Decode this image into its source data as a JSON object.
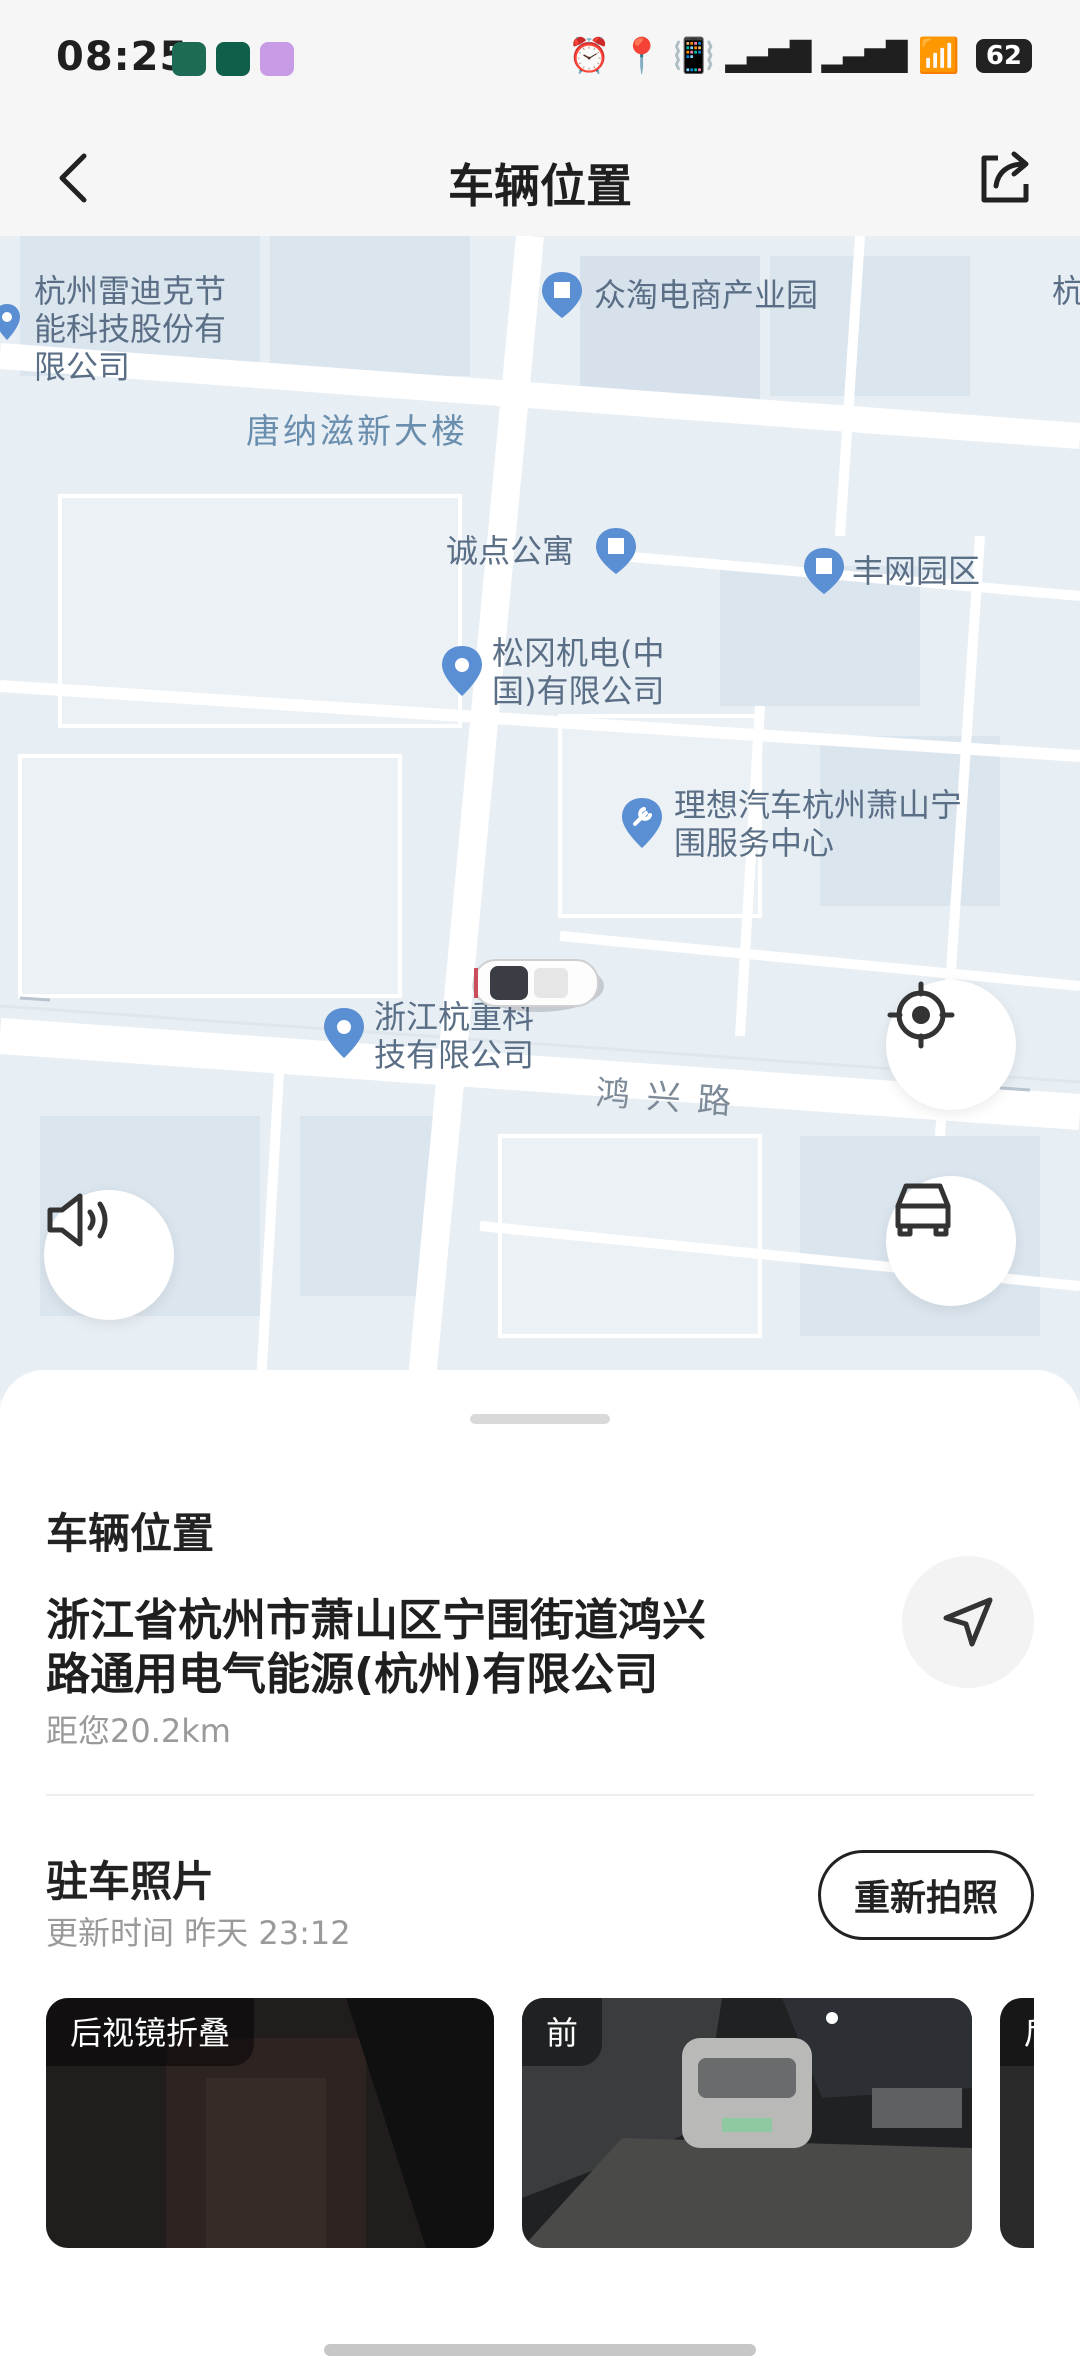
{
  "status_bar": {
    "time": "08:25",
    "battery": "62"
  },
  "header": {
    "title": "车辆位置"
  },
  "map": {
    "road_label": "鸿 兴 路",
    "pois": [
      "杭州雷迪克节能科技股份有限公司",
      "众淘电商产业园",
      "唐纳滋新大楼",
      "诚点公寓",
      "丰网园区",
      "松冈机电(中国)有限公司",
      "理想汽车杭州萧山宁围服务中心",
      "浙江杭重科技有限公司",
      "杭"
    ]
  },
  "vehicle_location": {
    "section_title": "车辆位置",
    "address_line1": "浙江省杭州市萧山区宁围街道鸿兴",
    "address_line2": "路通用电气能源(杭州)有限公司",
    "distance": "距您20.2km"
  },
  "parking_photos": {
    "section_title": "驻车照片",
    "update_time": "更新时间 昨天 23:12",
    "retake_label": "重新拍照",
    "photos": [
      {
        "tag": "后视镜折叠"
      },
      {
        "tag": "前"
      },
      {
        "tag": "后"
      }
    ]
  },
  "colors": {
    "map_background": "#e7eef4",
    "poi_pin": "#5b8fd4",
    "sheet_background": "#ffffff"
  }
}
